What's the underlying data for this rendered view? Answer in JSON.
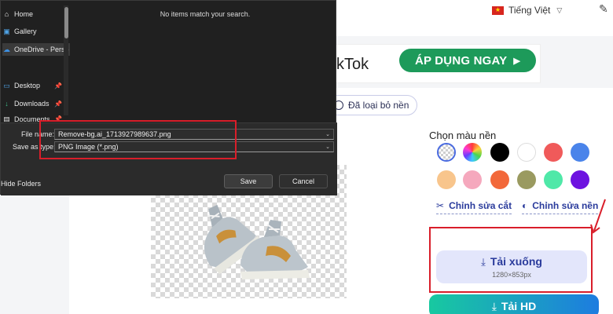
{
  "page": {
    "language_label": "Tiếng Việt",
    "banner_text": "kTok",
    "apply_button_label": "ÁP DỤNG NGAY",
    "removed_tag_label": "Đã loại bỏ nền",
    "color_section_title": "Chọn màu nền",
    "swatches": [
      "transparent",
      "rainbow",
      "#000000",
      "#ffffff",
      "#f05a5a",
      "#4a84ea",
      "#f8c58c",
      "#f5a8bd",
      "#f2683a",
      "#9a9a60",
      "#4fe8a8",
      "#6d12e0"
    ],
    "edit_cut_label": "Chỉnh sửa cắt",
    "edit_background_label": "Chỉnh sửa nền",
    "download_label": "Tải xuống",
    "download_size": "1280×853px",
    "hd_label": "Tải HD"
  },
  "dialog": {
    "nav_items": [
      {
        "label": "Home",
        "icon": "home-icon",
        "pinned": false
      },
      {
        "label": "Gallery",
        "icon": "gallery-icon",
        "pinned": false
      },
      {
        "label": "OneDrive - Perso",
        "icon": "cloud-icon",
        "pinned": false
      },
      {
        "label": "Desktop",
        "icon": "desktop-icon",
        "pinned": true
      },
      {
        "label": "Downloads",
        "icon": "download-icon",
        "pinned": true
      },
      {
        "label": "Documents",
        "icon": "document-icon",
        "pinned": true
      }
    ],
    "empty_message": "No items match your search.",
    "file_name_label": "File name:",
    "file_name_value": "Remove-bg.ai_1713927989637.png",
    "save_type_label": "Save as type:",
    "save_type_value": "PNG Image (*.png)",
    "hide_folders_label": "Hide Folders",
    "save_label": "Save",
    "cancel_label": "Cancel"
  },
  "colors": {
    "accent_green": "#1d9a5a",
    "highlight_red": "#d91e2a",
    "link_blue": "#2a3b9c"
  }
}
